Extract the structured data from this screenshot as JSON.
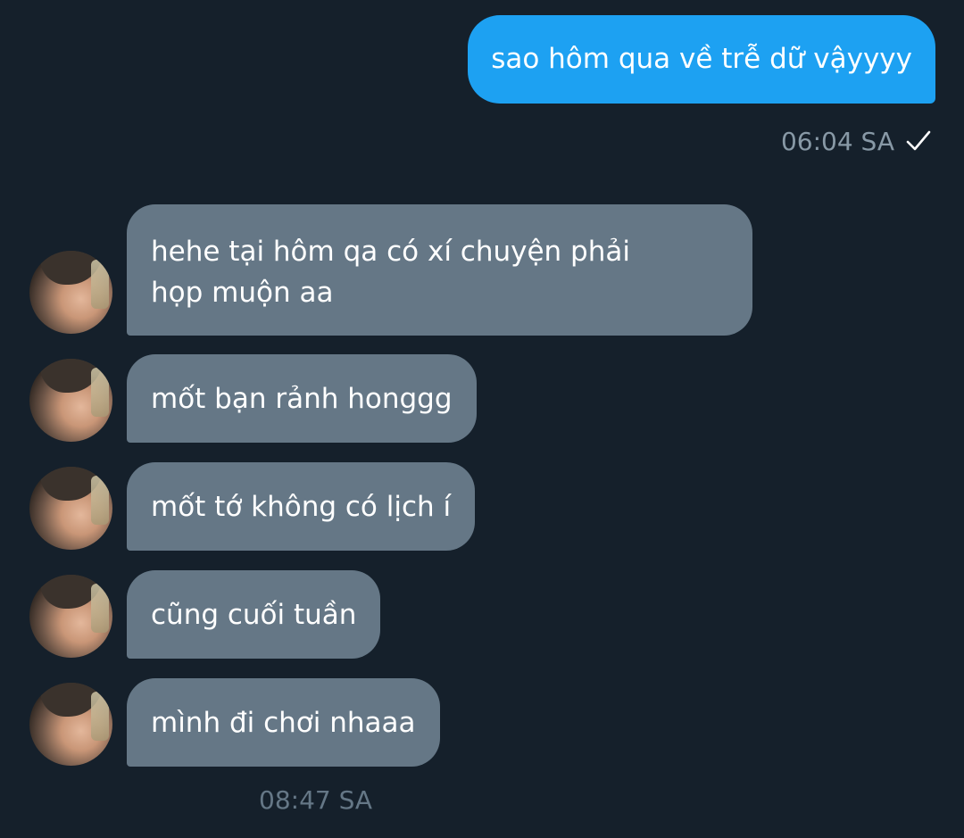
{
  "outgoing": {
    "text": "sao hôm qua về trễ dữ vậyyyy",
    "time": "06:04 SA"
  },
  "incoming": {
    "messages": [
      {
        "text": "hehe tại hôm qa có xí chuyện phải họp muộn aa"
      },
      {
        "text": "mốt bạn rảnh honggg"
      },
      {
        "text": "mốt tớ không có lịch í"
      },
      {
        "text": "cũng cuối tuần"
      },
      {
        "text": "mình đi chơi nhaaa"
      }
    ],
    "time": "08:47 SA"
  },
  "colors": {
    "background": "#15202b",
    "outgoing_bubble": "#1da1f2",
    "incoming_bubble": "#657786",
    "meta_text": "#8899a6"
  },
  "icons": {
    "read_receipt": "check-icon",
    "sender_avatar": "avatar"
  }
}
